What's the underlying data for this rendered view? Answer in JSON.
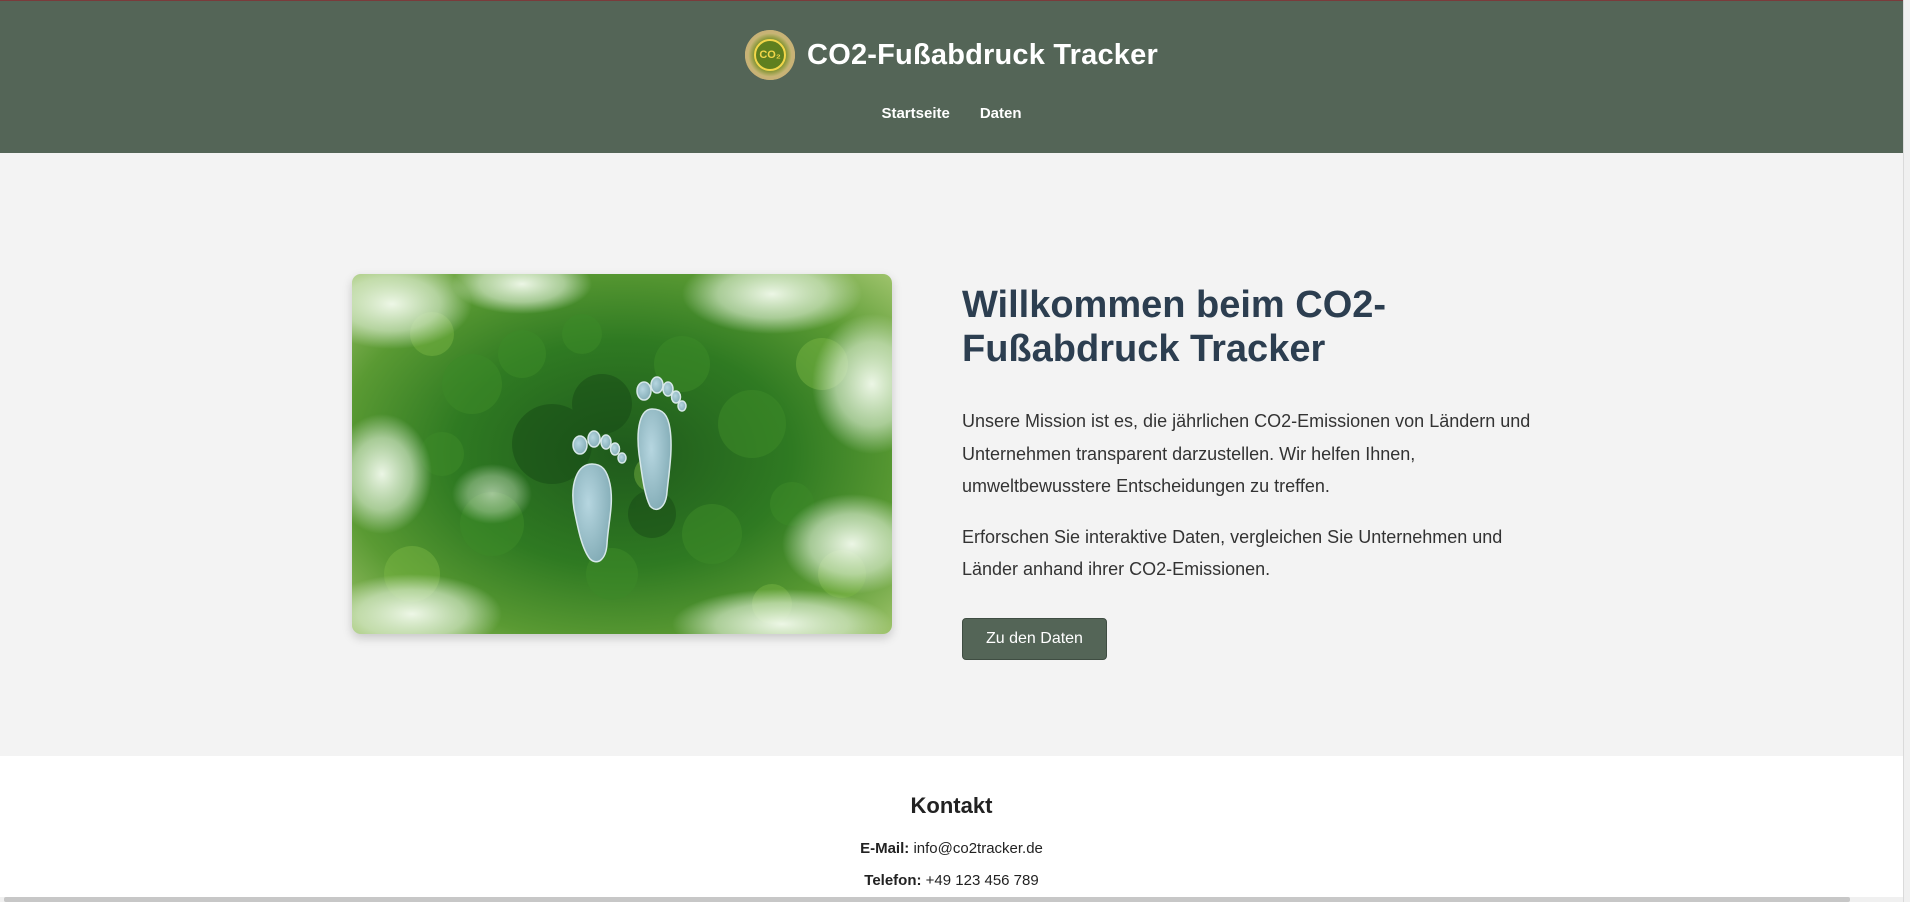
{
  "header": {
    "logo_text": "CO₂",
    "title": "CO2-Fußabdruck Tracker",
    "nav": [
      {
        "label": "Startseite"
      },
      {
        "label": "Daten"
      }
    ]
  },
  "hero": {
    "heading": "Willkommen beim CO2-Fußabdruck Tracker",
    "paragraph1": "Unsere Mission ist es, die jährlichen CO2-Emissionen von Ländern und Unternehmen transparent darzustellen. Wir helfen Ihnen, umweltbewusstere Entscheidungen zu treffen.",
    "paragraph2": "Erforschen Sie interaktive Daten, vergleichen Sie Unternehmen und Länder anhand ihrer CO2-Emissionen.",
    "cta_label": "Zu den Daten"
  },
  "footer": {
    "title": "Kontakt",
    "email_label": "E-Mail:",
    "email_value": "info@co2tracker.de",
    "phone_label": "Telefon:",
    "phone_value": "+49 123 456 789"
  },
  "colors": {
    "header_bg": "#546557",
    "heading_text": "#2c3e50",
    "button_bg": "#546557",
    "page_bg": "#f3f3f3"
  },
  "icons": {
    "logo": "co2-leaf-logo-icon",
    "hero_image": "footprints-in-forest-image"
  }
}
